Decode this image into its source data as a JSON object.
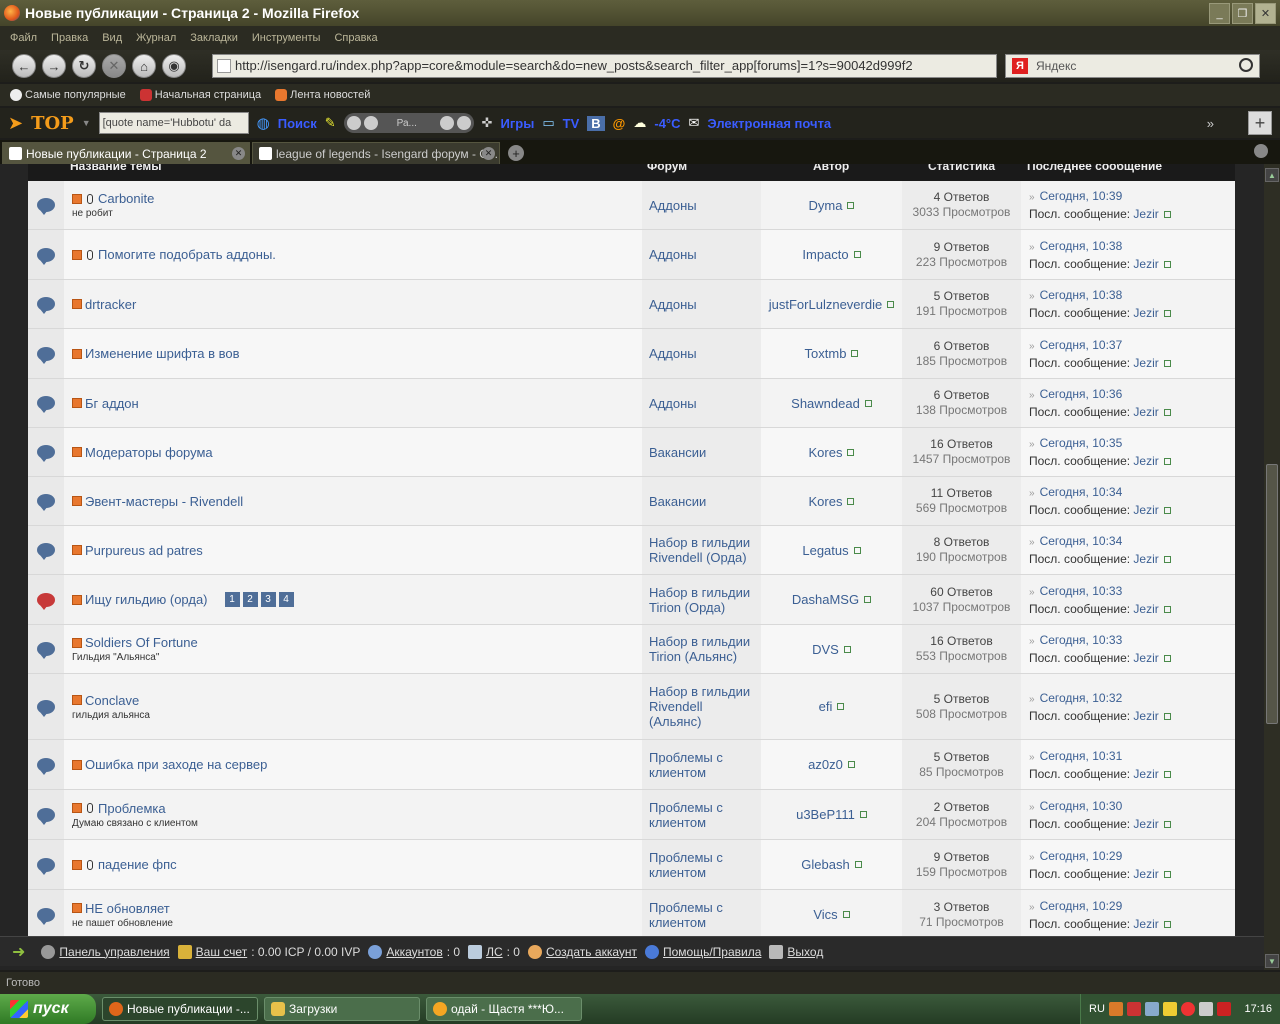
{
  "window": {
    "title": "Новые публикации - Страница 2 - Mozilla Firefox"
  },
  "menu": [
    "Файл",
    "Правка",
    "Вид",
    "Журнал",
    "Закладки",
    "Инструменты",
    "Справка"
  ],
  "nav": {
    "url": "http://isengard.ru/index.php?app=core&module=search&do=new_posts&search_filter_app[forums]=1?s=90042d999f2",
    "search_placeholder": "Яндекс"
  },
  "bookmarks": [
    "Самые популярные",
    "Начальная страница",
    "Лента новостей"
  ],
  "toolbar": {
    "quote_box": "[quote name='Hubbotu' da",
    "search_label": "Поиск",
    "player_label": "Ра...",
    "games": "Игры",
    "tv": "TV",
    "temperature": "-4°C",
    "mail": "Электронная почта"
  },
  "tabs": [
    {
      "label": "Новые публикации - Страница 2",
      "active": true
    },
    {
      "label": "league of legends - Isengard форум - С...",
      "active": false
    }
  ],
  "table": {
    "headers": {
      "title": "Название темы",
      "forum": "Форум",
      "author": "Автор",
      "stats": "Статистика",
      "last": "Последнее сообщение"
    },
    "rows": [
      {
        "title": "Carbonite",
        "desc": "не робит",
        "clip": true,
        "forum": "Аддоны",
        "author": "Dyma",
        "replies": "4 Ответов",
        "views": "3033 Просмотров",
        "last_date": "Сегодня, 10:39",
        "last_by_label": "Посл. сообщение:",
        "last_by": "Jezir",
        "hot": false
      },
      {
        "title": "Помогите подобрать аддоны.",
        "desc": "",
        "clip": true,
        "forum": "Аддоны",
        "author": "Impacto",
        "replies": "9 Ответов",
        "views": "223 Просмотров",
        "last_date": "Сегодня, 10:38",
        "last_by_label": "Посл. сообщение:",
        "last_by": "Jezir",
        "hot": false
      },
      {
        "title": "drtracker",
        "desc": "",
        "clip": false,
        "forum": "Аддоны",
        "author": "justForLulzneverdie",
        "replies": "5 Ответов",
        "views": "191 Просмотров",
        "last_date": "Сегодня, 10:38",
        "last_by_label": "Посл. сообщение:",
        "last_by": "Jezir",
        "hot": false
      },
      {
        "title": "Изменение шрифта в вов",
        "desc": "",
        "clip": false,
        "forum": "Аддоны",
        "author": "Toxtmb",
        "replies": "6 Ответов",
        "views": "185 Просмотров",
        "last_date": "Сегодня, 10:37",
        "last_by_label": "Посл. сообщение:",
        "last_by": "Jezir",
        "hot": false
      },
      {
        "title": "Бг аддон",
        "desc": "",
        "clip": false,
        "forum": "Аддоны",
        "author": "Shawndead",
        "replies": "6 Ответов",
        "views": "138 Просмотров",
        "last_date": "Сегодня, 10:36",
        "last_by_label": "Посл. сообщение:",
        "last_by": "Jezir",
        "hot": false
      },
      {
        "title": "Модераторы форума",
        "desc": "",
        "clip": false,
        "forum": "Вакансии",
        "author": "Kores",
        "replies": "16 Ответов",
        "views": "1457 Просмотров",
        "last_date": "Сегодня, 10:35",
        "last_by_label": "Посл. сообщение:",
        "last_by": "Jezir",
        "hot": false
      },
      {
        "title": "Эвент-мастеры - Rivendell",
        "desc": "",
        "clip": false,
        "forum": "Вакансии",
        "author": "Kores",
        "replies": "11 Ответов",
        "views": "569 Просмотров",
        "last_date": "Сегодня, 10:34",
        "last_by_label": "Посл. сообщение:",
        "last_by": "Jezir",
        "hot": false
      },
      {
        "title": "Purpureus ad patres",
        "desc": "",
        "clip": false,
        "forum": "Набор в гильдии Rivendell (Орда)",
        "author": "Legatus",
        "replies": "8 Ответов",
        "views": "190 Просмотров",
        "last_date": "Сегодня, 10:34",
        "last_by_label": "Посл. сообщение:",
        "last_by": "Jezir",
        "hot": false
      },
      {
        "title": "Ищу гильдию (орда)",
        "desc": "",
        "clip": false,
        "pages": [
          "1",
          "2",
          "3",
          "4"
        ],
        "forum": "Набор в гильдии Tirion (Орда)",
        "author": "DashaMSG",
        "replies": "60 Ответов",
        "views": "1037 Просмотров",
        "last_date": "Сегодня, 10:33",
        "last_by_label": "Посл. сообщение:",
        "last_by": "Jezir",
        "hot": true
      },
      {
        "title": "Soldiers Of Fortune",
        "desc": "Гильдия \"Альянса\"",
        "clip": false,
        "forum": "Набор в гильдии Tirion (Альянс)",
        "author": "DVS",
        "replies": "16 Ответов",
        "views": "553 Просмотров",
        "last_date": "Сегодня, 10:33",
        "last_by_label": "Посл. сообщение:",
        "last_by": "Jezir",
        "hot": false
      },
      {
        "title": "Conclave",
        "desc": "гильдия альянса",
        "clip": false,
        "forum": "Набор в гильдии Rivendell (Альянс)",
        "author": "efi",
        "replies": "5 Ответов",
        "views": "508 Просмотров",
        "last_date": "Сегодня, 10:32",
        "last_by_label": "Посл. сообщение:",
        "last_by": "Jezir",
        "hot": false
      },
      {
        "title": "Ошибка при заходе на сервер",
        "desc": "",
        "clip": false,
        "forum": "Проблемы с клиентом",
        "author": "az0z0",
        "replies": "5 Ответов",
        "views": "85 Просмотров",
        "last_date": "Сегодня, 10:31",
        "last_by_label": "Посл. сообщение:",
        "last_by": "Jezir",
        "hot": false
      },
      {
        "title": "Проблемка",
        "desc": "Думаю связано с клиентом",
        "clip": true,
        "forum": "Проблемы с клиентом",
        "author": "u3BeP111",
        "replies": "2 Ответов",
        "views": "204 Просмотров",
        "last_date": "Сегодня, 10:30",
        "last_by_label": "Посл. сообщение:",
        "last_by": "Jezir",
        "hot": false
      },
      {
        "title": "падение фпс",
        "desc": "",
        "clip": true,
        "forum": "Проблемы с клиентом",
        "author": "Glebash",
        "replies": "9 Ответов",
        "views": "159 Просмотров",
        "last_date": "Сегодня, 10:29",
        "last_by_label": "Посл. сообщение:",
        "last_by": "Jezir",
        "hot": false
      },
      {
        "title": "НЕ обновляет",
        "desc": "не пашет обновление",
        "clip": false,
        "forum": "Проблемы с клиентом",
        "author": "Vics",
        "replies": "3 Ответов",
        "views": "71 Просмотров",
        "last_date": "Сегодня, 10:29",
        "last_by_label": "Посл. сообщение:",
        "last_by": "Jezir",
        "hot": false
      }
    ]
  },
  "adminbar": {
    "panel": "Панель управления",
    "account_label": "Ваш счет",
    "account_value": ": 0.00 ICP / 0.00 IVP",
    "accounts_label": "Аккаунтов",
    "accounts_value": ": 0",
    "pm_label": "ЛС",
    "pm_value": ": 0",
    "create": "Создать аккаунт",
    "help": "Помощь/Правила",
    "logout": "Выход"
  },
  "status": "Готово",
  "taskbar": {
    "start": "пуск",
    "tasks": [
      "Новые публикации -...",
      "Загрузки",
      "одай - Щастя ***Ю..."
    ],
    "lang": "RU",
    "clock": "17:16"
  }
}
